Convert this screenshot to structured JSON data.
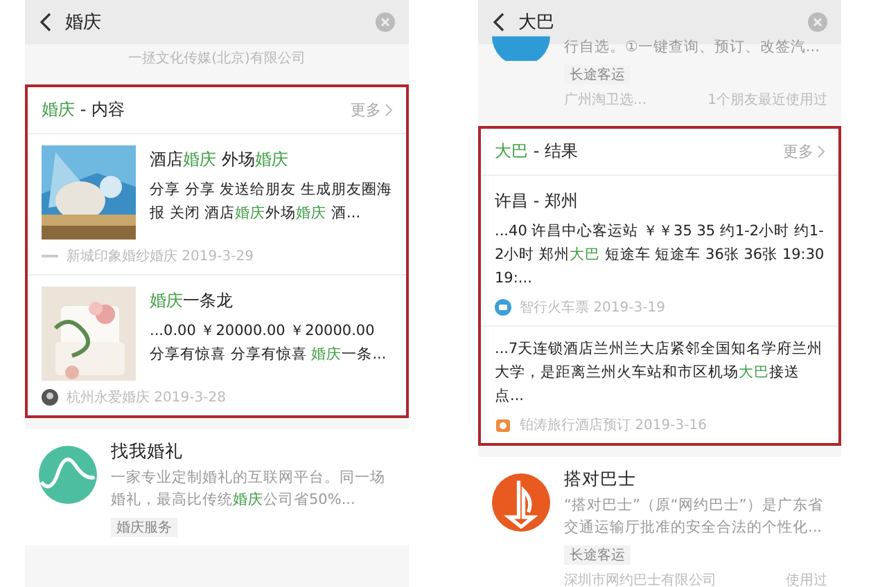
{
  "screens": [
    {
      "search": {
        "value": "婚庆"
      },
      "blocks": [
        {
          "kind": "partial_text",
          "text": "一拯文化传媒(北京)有限公司"
        },
        {
          "kind": "section",
          "title": "**婚庆** - 内容",
          "more": "更多",
          "items": [
            {
              "kind": "thumb",
              "title": "酒店**婚庆** 外场**婚庆**",
              "snippet": "分享 分享 发送给朋友 生成朋友圈海报 关闭 酒店**婚庆**外场**婚庆** 酒...",
              "source": "新城印象婚纱婚庆 2019-3-29"
            },
            {
              "kind": "thumb",
              "title": "**婚庆**一条龙",
              "snippet": "...0.00 ￥20000.00 ￥20000.00 分享有惊喜 分享有惊喜 **婚庆**一条...",
              "source": "杭州永爱婚庆 2019-3-28"
            }
          ]
        },
        {
          "kind": "app",
          "title": "找我婚礼",
          "desc": "一家专业定制婚礼的互联网平台。同一场婚礼，最高比传统**婚庆**公司省50%...",
          "tag": "婚庆服务"
        }
      ]
    },
    {
      "search": {
        "value": "大巴"
      },
      "blocks": [
        {
          "kind": "partial_app",
          "desc": "行自选。①一键查询、预订、改签汽...",
          "tag": "长途客运",
          "owner": "广州淘卫选...",
          "usage": "1个朋友最近使用过"
        },
        {
          "kind": "section",
          "title": "**大巴** - 结果",
          "more": "更多",
          "items": [
            {
              "kind": "text",
              "title": "许昌 - 郑州",
              "snippet": "...40 许昌中心客运站 ￥￥35 35 约1-2小时 约1-2小时 郑州**大巴** 短途车 短途车 36张 36张 19:30 19:...",
              "source": "智行火车票 2019-3-19"
            },
            {
              "kind": "text",
              "snippet": "...7天连锁酒店兰州兰大店紧邻全国知名学府兰州大学，是距离兰州火车站和市区机场**大巴**接送点...",
              "source": "铂涛旅行酒店预订 2019-3-16"
            }
          ]
        },
        {
          "kind": "app",
          "title": "搭对巴士",
          "desc": "“搭对巴士”（原“网约巴士”）是广东省交通运输厅批准的安全合法的个性化...",
          "tag": "长途客运",
          "owner": "深圳市网约巴士有限公司",
          "usage": "使用过"
        }
      ]
    }
  ]
}
